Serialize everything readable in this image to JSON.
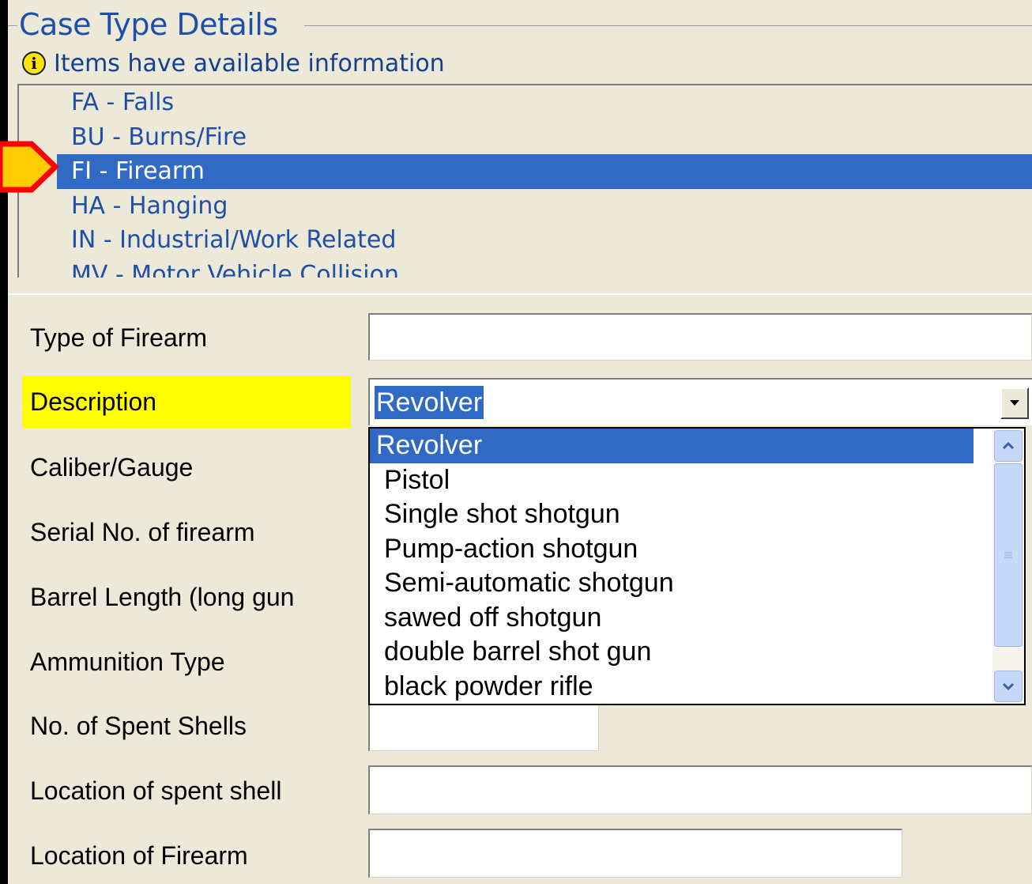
{
  "group": {
    "title": "Case Type Details",
    "info_text": "Items have available information",
    "info_icon": "info-icon"
  },
  "case_types": [
    {
      "label": "FA - Falls",
      "selected": false
    },
    {
      "label": "BU - Burns/Fire",
      "selected": false
    },
    {
      "label": "FI - Firearm",
      "selected": true
    },
    {
      "label": "HA - Hanging",
      "selected": false
    },
    {
      "label": "IN - Industrial/Work Related",
      "selected": false
    },
    {
      "label": "MV - Motor Vehicle Collision",
      "selected": false
    }
  ],
  "form": {
    "type_of_firearm": {
      "label": "Type of Firearm",
      "value": ""
    },
    "description": {
      "label": "Description",
      "value": "Revolver"
    },
    "caliber_gauge": {
      "label": "Caliber/Gauge"
    },
    "serial_no": {
      "label": "Serial No. of firearm"
    },
    "barrel_length": {
      "label": "Barrel Length (long gun"
    },
    "ammunition_type": {
      "label": "Ammunition Type"
    },
    "spent_shells": {
      "label": "No. of Spent Shells",
      "value": ""
    },
    "location_spent_shell": {
      "label": "Location of spent shell",
      "value": ""
    },
    "location_firearm": {
      "label": "Location of Firearm",
      "value": ""
    }
  },
  "description_options": [
    "Revolver",
    "Pistol",
    "Single shot shotgun",
    "Pump-action shotgun",
    "Semi-automatic shotgun",
    "sawed off shotgun",
    "double barrel shot gun",
    "black powder rifle"
  ],
  "colors": {
    "selection": "#316ac5",
    "highlight": "#ffff00",
    "pointer_fill": "#ffcc00",
    "pointer_border": "#ff0000"
  }
}
